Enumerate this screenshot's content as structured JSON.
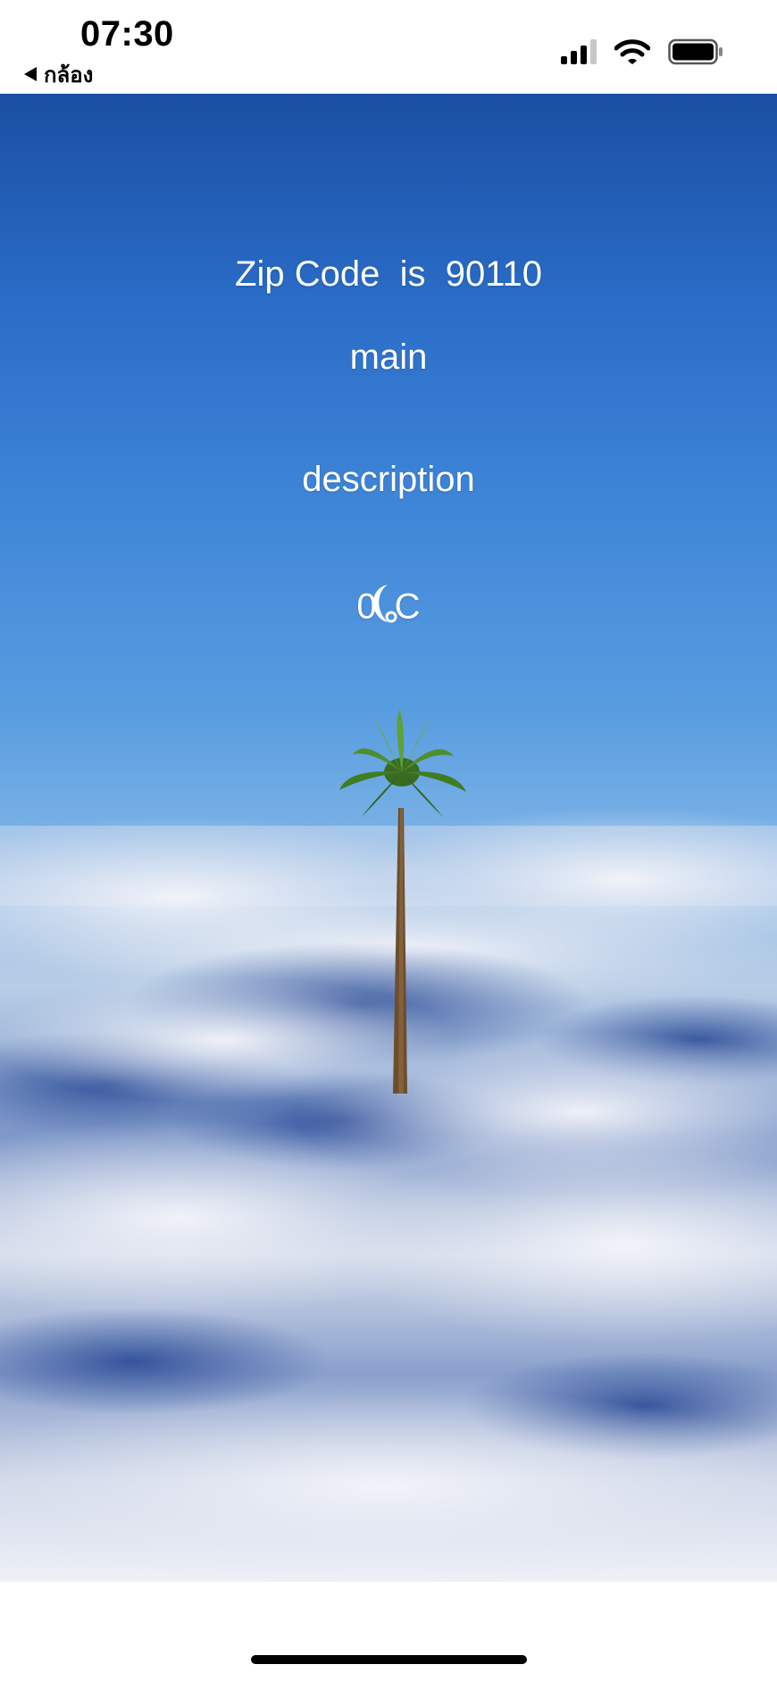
{
  "status_bar": {
    "time": "07:30",
    "back_label": "กล้อง",
    "signal_icon": "cellular-signal-icon",
    "wifi_icon": "wifi-icon",
    "battery_icon": "battery-icon"
  },
  "weather": {
    "zip_prefix": "Zip Code",
    "zip_is": "is",
    "zip_code": "90110",
    "main": "main",
    "description": "description",
    "temp_value": "0",
    "temp_unit": "C",
    "weather_icon": "moon-icon",
    "background": "palm-tree-above-clouds"
  },
  "colors": {
    "sky_top": "#1a4fa3",
    "sky_mid": "#5a9ee0",
    "cloud": "#e8ecf5",
    "text": "#ffffff"
  }
}
